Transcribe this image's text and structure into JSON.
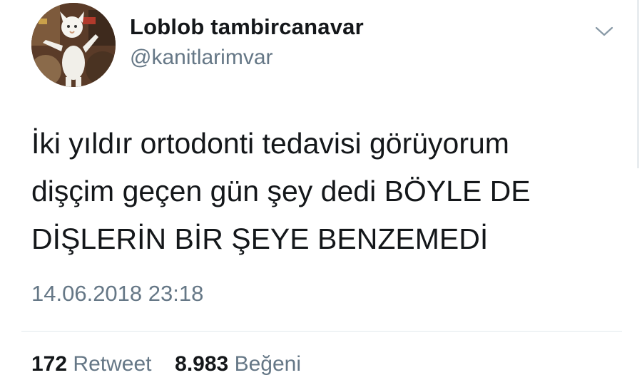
{
  "user": {
    "display_name": "Loblob tambircanavar",
    "handle": "@kanitlarimvar",
    "avatar_icon": "avatar-persian-cat-icon"
  },
  "menu": {
    "icon": "chevron-down-icon"
  },
  "tweet": {
    "lines": [
      "İki yıldır ortodonti tedavisi görüyorum",
      "dişçim geçen gün şey dedi BÖYLE DE",
      "DİŞLERİN BİR ŞEYE BENZEMEDİ"
    ],
    "timestamp": "14.06.2018 23:18"
  },
  "stats": {
    "retweet_count": "172",
    "retweet_label": "Retweet",
    "like_count": "8.983",
    "like_label": "Beğeni"
  },
  "colors": {
    "primary_text": "#14171a",
    "secondary_text": "#657786",
    "divider": "#e1e8ed"
  }
}
